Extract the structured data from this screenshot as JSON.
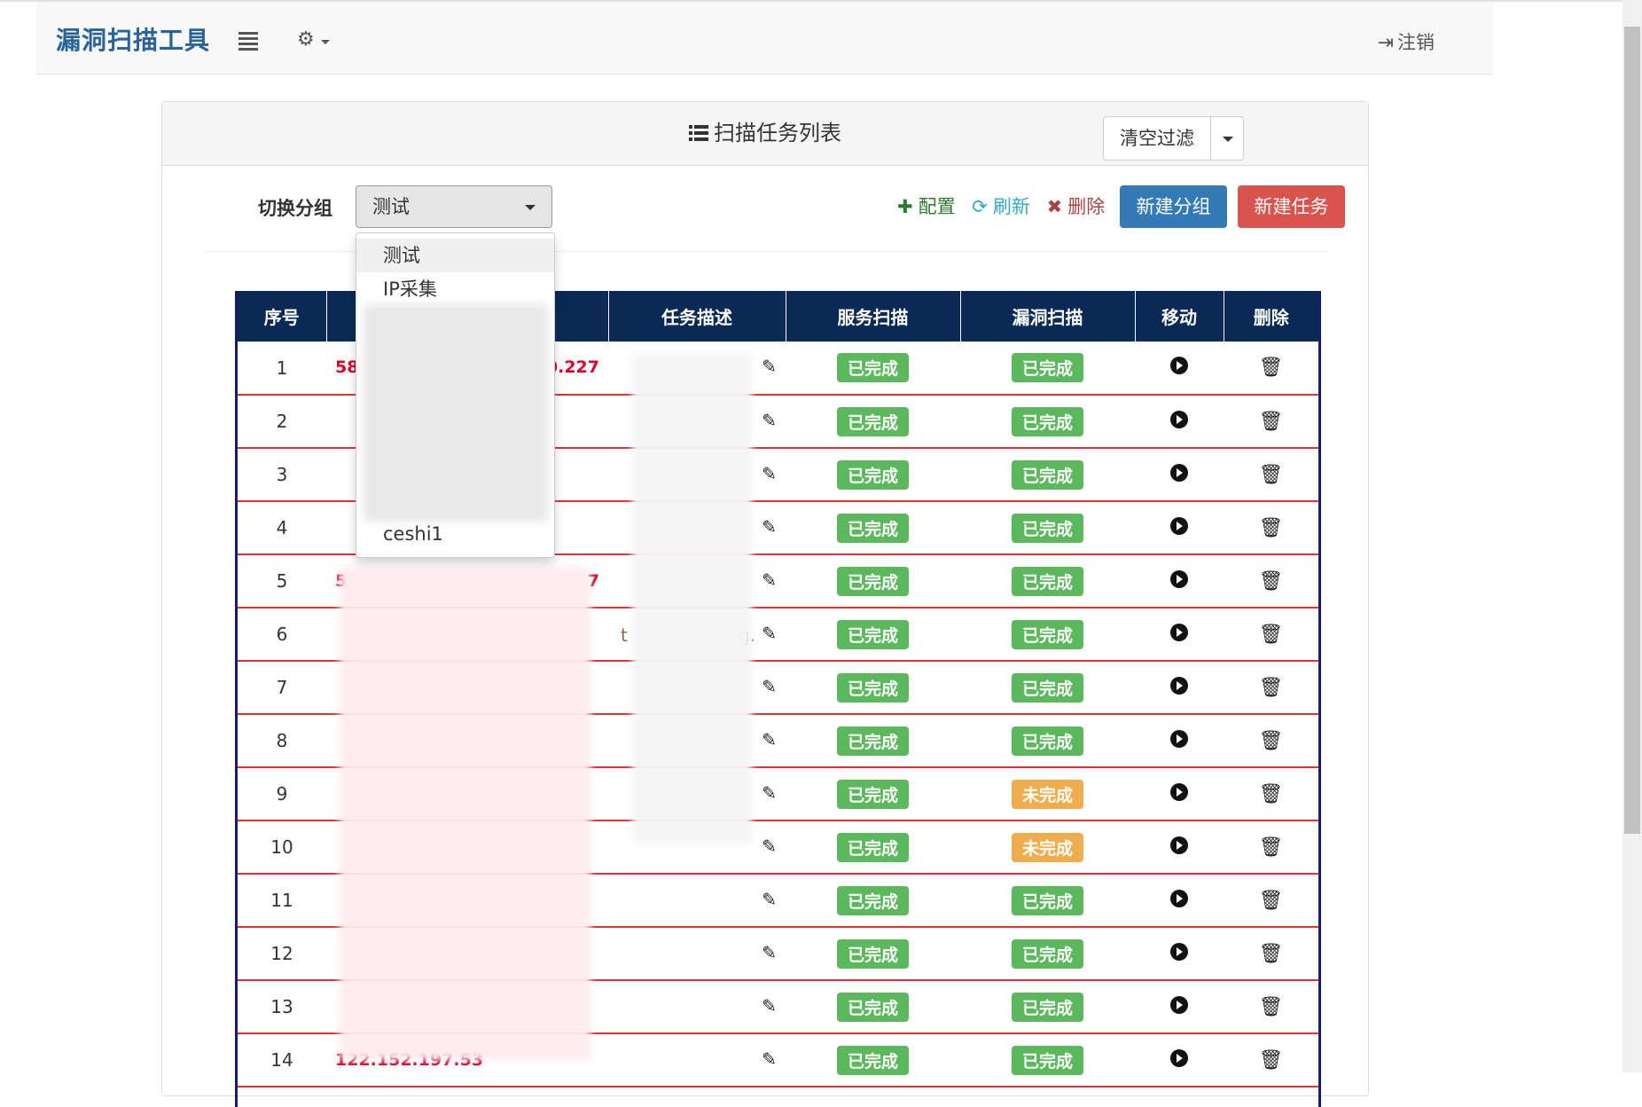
{
  "app": {
    "brand": "漏洞扫描工具",
    "logout_label": "注销"
  },
  "panel": {
    "title": "扫描任务列表",
    "clear_filter_label": "清空过滤"
  },
  "toolbar": {
    "group_label": "切换分组",
    "selected_group": "测试",
    "config_label": "配置",
    "refresh_label": "刷新",
    "delete_label": "删除",
    "new_group_label": "新建分组",
    "new_task_label": "新建任务"
  },
  "dropdown": {
    "options": [
      "测试",
      "IP采集",
      "ceshi1"
    ]
  },
  "table": {
    "headers": [
      "序号",
      "",
      "任务描述",
      "服务扫描",
      "漏洞扫描",
      "移动",
      "删除"
    ],
    "rows": [
      {
        "index": "1",
        "target": "58",
        "target_tail": "0.227",
        "desc": "",
        "service": "已完成",
        "vuln": "已完成"
      },
      {
        "index": "2",
        "target": "",
        "target_tail": "",
        "desc": "",
        "service": "已完成",
        "vuln": "已完成"
      },
      {
        "index": "3",
        "target": "",
        "target_tail": "",
        "desc": "",
        "service": "已完成",
        "vuln": "已完成"
      },
      {
        "index": "4",
        "target": "",
        "target_tail": "",
        "desc": "",
        "service": "已完成",
        "vuln": "已完成"
      },
      {
        "index": "5",
        "target": "5",
        "target_tail": "7",
        "desc": "",
        "service": "已完成",
        "vuln": "已完成"
      },
      {
        "index": "6",
        "target": "",
        "target_tail": "",
        "desc": "t",
        "desc_tail": "g.",
        "service": "已完成",
        "vuln": "已完成"
      },
      {
        "index": "7",
        "target": "",
        "target_tail": "",
        "desc": "",
        "service": "已完成",
        "vuln": "已完成"
      },
      {
        "index": "8",
        "target": "",
        "target_tail": "",
        "desc": "",
        "service": "已完成",
        "vuln": "已完成"
      },
      {
        "index": "9",
        "target": "",
        "target_tail": "",
        "desc": "",
        "service": "已完成",
        "vuln": "未完成"
      },
      {
        "index": "10",
        "target": "",
        "target_tail": "",
        "desc": "",
        "service": "已完成",
        "vuln": "未完成"
      },
      {
        "index": "11",
        "target": "",
        "target_tail": "",
        "desc": "",
        "service": "已完成",
        "vuln": "已完成"
      },
      {
        "index": "12",
        "target": "",
        "target_tail": "",
        "desc": "",
        "service": "已完成",
        "vuln": "已完成"
      },
      {
        "index": "13",
        "target": "",
        "target_tail": "",
        "desc": "",
        "service": "已完成",
        "vuln": "已完成"
      },
      {
        "index": "14",
        "target": "122.152.197.53",
        "target_tail": "",
        "desc": "",
        "service": "已完成",
        "vuln": "已完成"
      }
    ]
  },
  "colors": {
    "brand": "#2a6496",
    "header_bg": "#0a2a55",
    "row_border": "#e0303a",
    "done": "#5cb85c",
    "undone": "#f0ad4e",
    "primary": "#337ab7",
    "danger": "#d9534f"
  }
}
